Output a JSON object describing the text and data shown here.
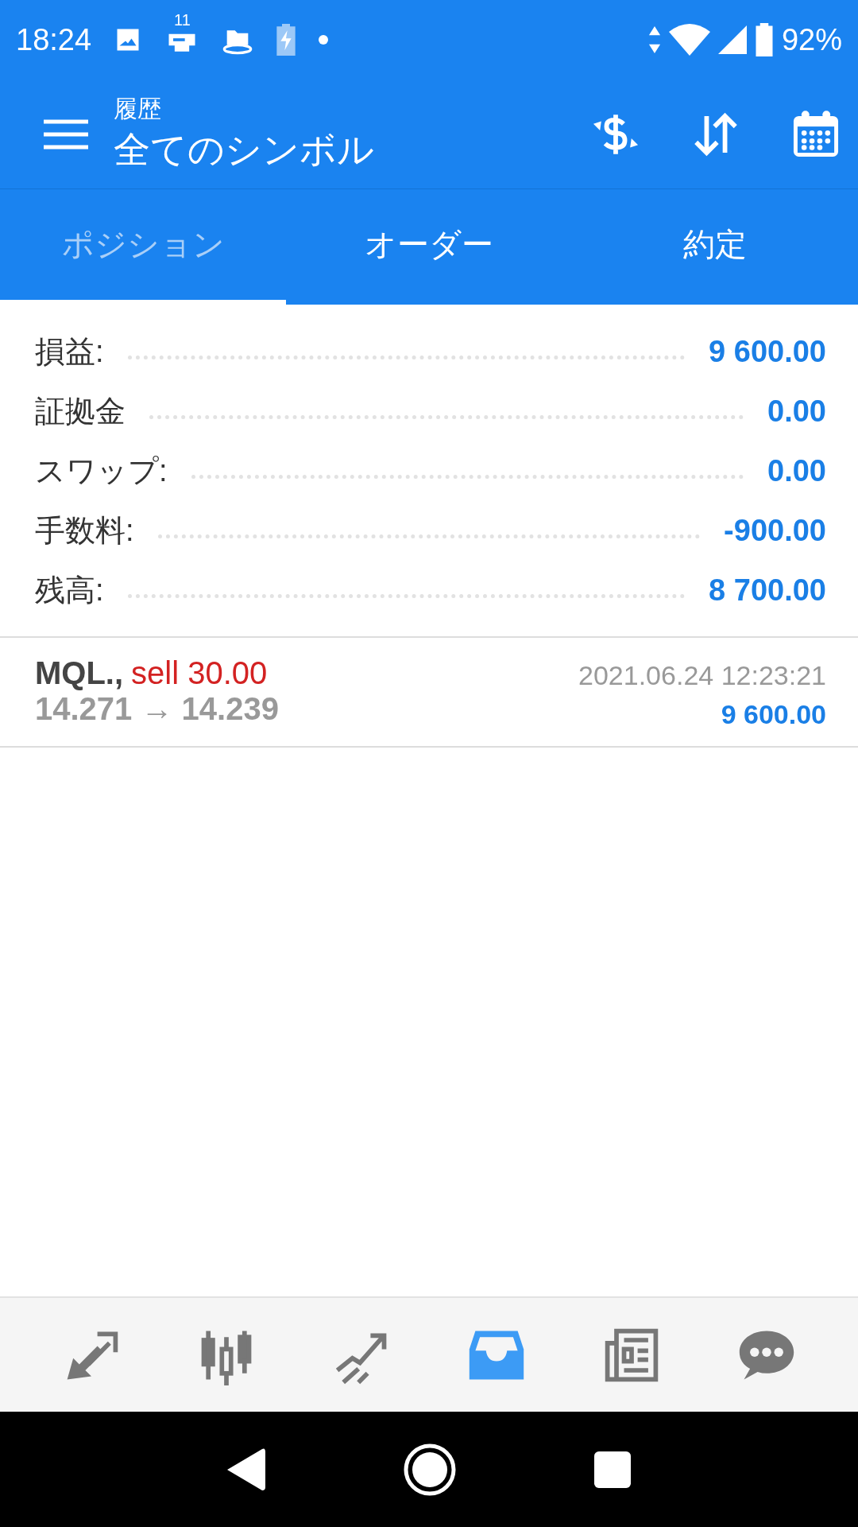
{
  "status_bar": {
    "time": "18:24",
    "notification_count": "11",
    "battery": "92%"
  },
  "header": {
    "subtitle": "履歴",
    "title": "全てのシンボル"
  },
  "tabs": [
    {
      "label": "ポジション",
      "selected": true
    },
    {
      "label": "オーダー",
      "selected": false
    },
    {
      "label": "約定",
      "selected": false
    }
  ],
  "summary": [
    {
      "label": "損益:",
      "value": "9 600.00"
    },
    {
      "label": "証拠金",
      "value": "0.00"
    },
    {
      "label": "スワップ:",
      "value": "0.00"
    },
    {
      "label": "手数料:",
      "value": "-900.00"
    },
    {
      "label": "残高:",
      "value": "8 700.00"
    }
  ],
  "deals": [
    {
      "symbol": "MQL.,",
      "action": "sell 30.00",
      "prices": "14.271 → 14.239",
      "time": "2021.06.24 12:23:21",
      "profit": "9 600.00"
    }
  ],
  "bottom_nav": [
    {
      "kind": "trade",
      "selected": false
    },
    {
      "kind": "quotes",
      "selected": false
    },
    {
      "kind": "chart",
      "selected": false
    },
    {
      "kind": "history",
      "selected": true
    },
    {
      "kind": "news",
      "selected": false
    },
    {
      "kind": "chat",
      "selected": false
    }
  ]
}
